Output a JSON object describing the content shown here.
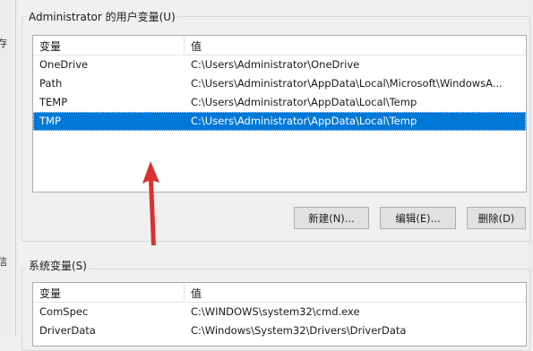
{
  "user_vars": {
    "group_title": "Administrator 的用户变量(U)",
    "headers": {
      "name": "变量",
      "value": "值"
    },
    "rows": [
      {
        "name": "OneDrive",
        "value": "C:\\Users\\Administrator\\OneDrive",
        "selected": false
      },
      {
        "name": "Path",
        "value": "C:\\Users\\Administrator\\AppData\\Local\\Microsoft\\WindowsA...",
        "selected": false
      },
      {
        "name": "TEMP",
        "value": "C:\\Users\\Administrator\\AppData\\Local\\Temp",
        "selected": false
      },
      {
        "name": "TMP",
        "value": "C:\\Users\\Administrator\\AppData\\Local\\Temp",
        "selected": true
      }
    ],
    "buttons": {
      "new": "新建(N)...",
      "edit": "编辑(E)...",
      "delete": "删除(D)"
    }
  },
  "system_vars": {
    "group_title": "系统变量(S)",
    "headers": {
      "name": "变量",
      "value": "值"
    },
    "rows": [
      {
        "name": "ComSpec",
        "value": "C:\\WINDOWS\\system32\\cmd.exe",
        "selected": false
      },
      {
        "name": "DriverData",
        "value": "C:\\Windows\\System32\\Drivers\\DriverData",
        "selected": false
      }
    ]
  },
  "left_fragments": {
    "top": "存",
    "bottom": "信"
  },
  "colors": {
    "selection": "#0078d7",
    "arrow": "#d9322e",
    "window_bg": "#f0f0f0"
  }
}
